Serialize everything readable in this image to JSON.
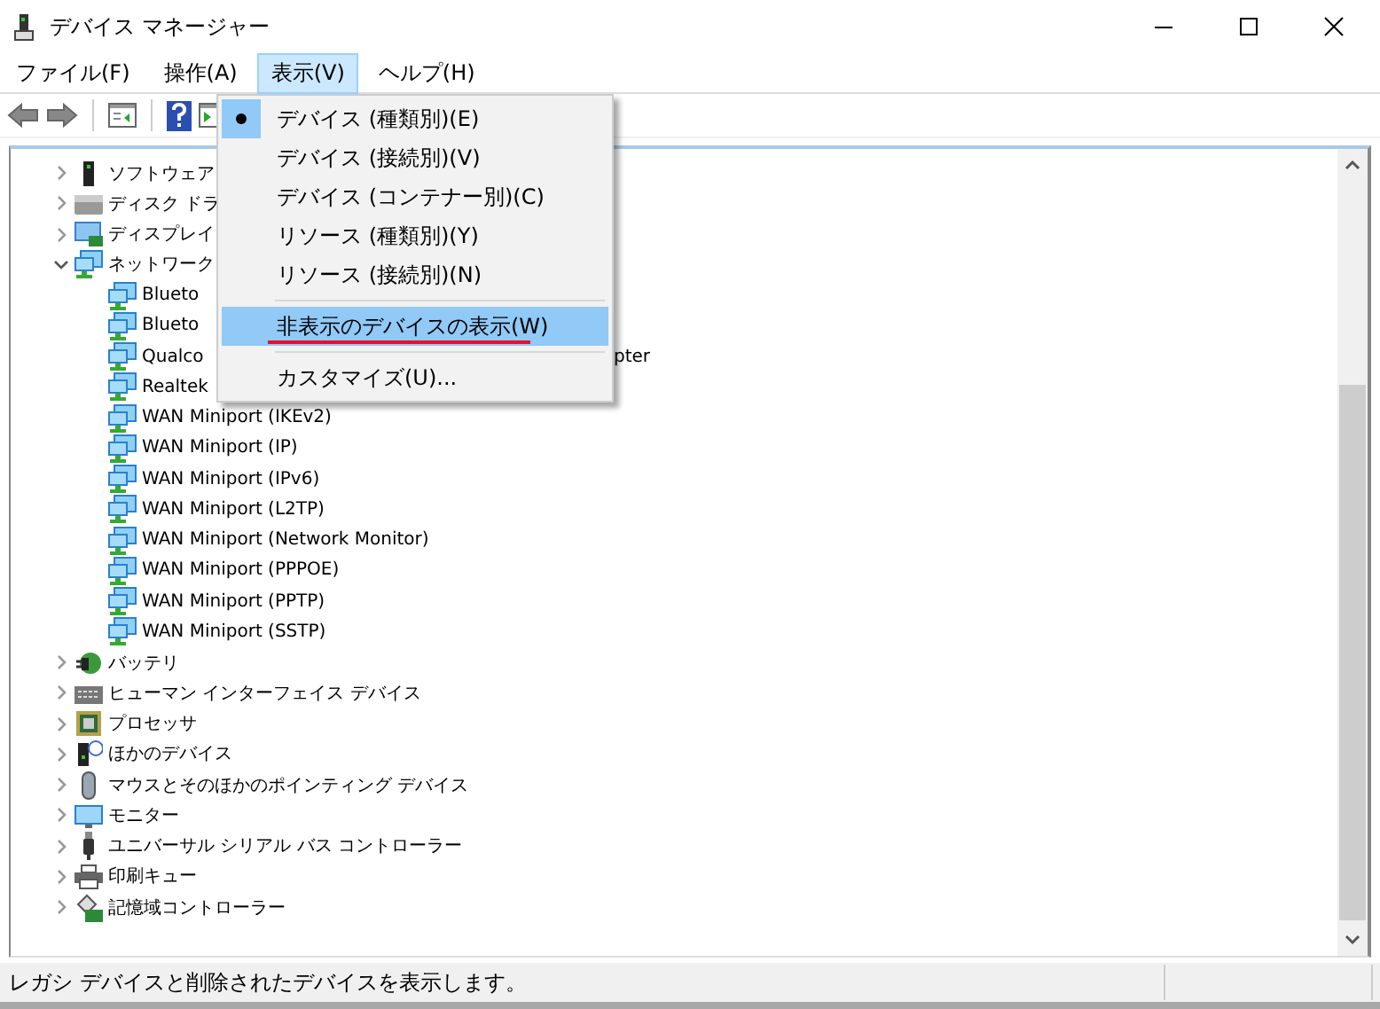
{
  "window": {
    "title": "デバイス マネージャー"
  },
  "menubar": [
    {
      "label": "ファイル(F)",
      "selected": false
    },
    {
      "label": "操作(A)",
      "selected": false
    },
    {
      "label": "表示(V)",
      "selected": true
    },
    {
      "label": "ヘルプ(H)",
      "selected": false
    }
  ],
  "menu": [
    {
      "kind": "item",
      "label": "デバイス (種類別)(E)",
      "checked": true,
      "selected": false,
      "underlined": false
    },
    {
      "kind": "item",
      "label": "デバイス (接続別)(V)",
      "checked": false,
      "selected": false,
      "underlined": false
    },
    {
      "kind": "item",
      "label": "デバイス (コンテナー別)(C)",
      "checked": false,
      "selected": false,
      "underlined": false
    },
    {
      "kind": "item",
      "label": "リソース (種類別)(Y)",
      "checked": false,
      "selected": false,
      "underlined": false
    },
    {
      "kind": "item",
      "label": "リソース (接続別)(N)",
      "checked": false,
      "selected": false,
      "underlined": false
    },
    {
      "kind": "separator"
    },
    {
      "kind": "item",
      "label": "非表示のデバイスの表示(W)",
      "checked": false,
      "selected": true,
      "underlined": true
    },
    {
      "kind": "separator"
    },
    {
      "kind": "item",
      "label": "カスタマイズ(U)...",
      "checked": false,
      "selected": false,
      "underlined": false
    }
  ],
  "tree": [
    {
      "label": "ソフトウェア",
      "kind": "software",
      "expanded": false
    },
    {
      "label": "ディスク ドラ",
      "kind": "disk",
      "expanded": false
    },
    {
      "label": "ディスプレイ",
      "kind": "display",
      "expanded": false
    },
    {
      "label": "ネットワーク",
      "kind": "network",
      "expanded": true,
      "children": [
        {
          "label": "Blueto",
          "kind": "network"
        },
        {
          "label": "Blueto",
          "kind": "network"
        },
        {
          "label": "Qualco",
          "tail": "pter",
          "kind": "network"
        },
        {
          "label": "Realtek",
          "kind": "network"
        },
        {
          "label": "WAN Miniport (IKEv2)",
          "kind": "network"
        },
        {
          "label": "WAN Miniport (IP)",
          "kind": "network"
        },
        {
          "label": "WAN Miniport (IPv6)",
          "kind": "network"
        },
        {
          "label": "WAN Miniport (L2TP)",
          "kind": "network"
        },
        {
          "label": "WAN Miniport (Network Monitor)",
          "kind": "network"
        },
        {
          "label": "WAN Miniport (PPPOE)",
          "kind": "network"
        },
        {
          "label": "WAN Miniport (PPTP)",
          "kind": "network"
        },
        {
          "label": "WAN Miniport (SSTP)",
          "kind": "network"
        }
      ]
    },
    {
      "label": "バッテリ",
      "kind": "battery",
      "expanded": false
    },
    {
      "label": "ヒューマン インターフェイス デバイス",
      "kind": "hid",
      "expanded": false
    },
    {
      "label": "プロセッサ",
      "kind": "cpu",
      "expanded": false
    },
    {
      "label": "ほかのデバイス",
      "kind": "other",
      "expanded": false
    },
    {
      "label": "マウスとそのほかのポインティング デバイス",
      "kind": "mouse",
      "expanded": false
    },
    {
      "label": "モニター",
      "kind": "monitor",
      "expanded": false
    },
    {
      "label": "ユニバーサル シリアル バス コントローラー",
      "kind": "usb",
      "expanded": false
    },
    {
      "label": "印刷キュー",
      "kind": "printer",
      "expanded": false
    },
    {
      "label": "記憶域コントローラー",
      "kind": "storage",
      "expanded": false
    }
  ],
  "status_bar": {
    "text": "レガシ デバイスと削除されたデバイスを表示します。"
  }
}
